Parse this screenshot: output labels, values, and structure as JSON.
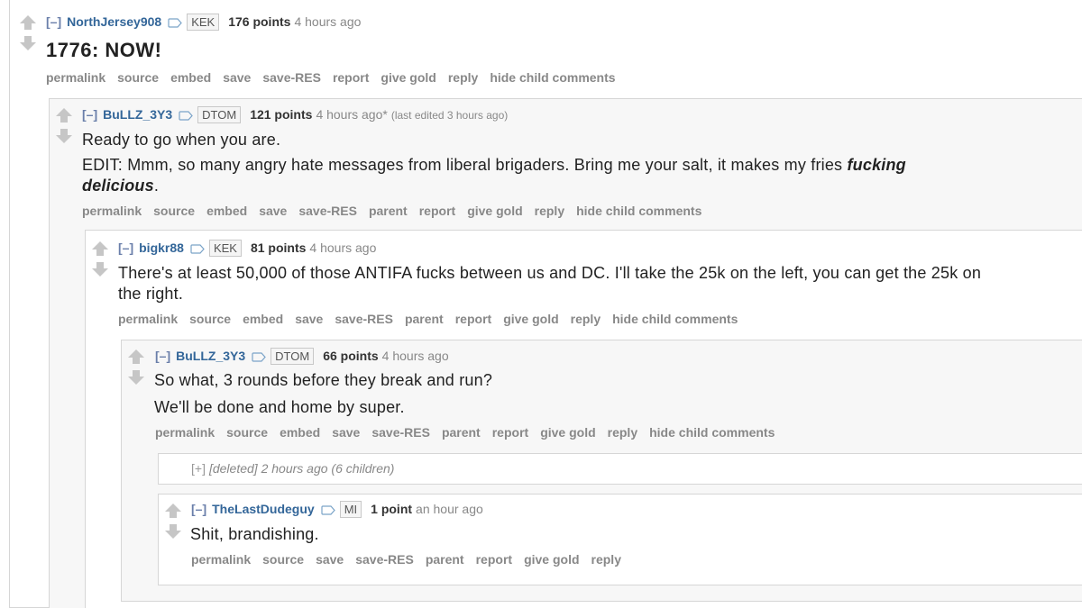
{
  "comments": [
    {
      "toggle": "[–]",
      "author": "NorthJersey908",
      "flair": "KEK",
      "score": "176 points",
      "time": "4 hours ago",
      "lines": [
        "1776: NOW!"
      ],
      "buttons": [
        "permalink",
        "source",
        "embed",
        "save",
        "save-RES",
        "report",
        "give gold",
        "reply",
        "hide child comments"
      ]
    },
    {
      "toggle": "[–]",
      "author": "BuLLZ_3Y3",
      "flair": "DTOM",
      "score": "121 points",
      "time": "4 hours ago*",
      "edited": "(last edited 3 hours ago)",
      "lines": [
        "Ready to go when you are.",
        "EDIT: Mmm, so many angry hate messages from liberal brigaders. Bring me your salt, it makes my fries"
      ],
      "emphasis_1": "fucking",
      "emphasis_2": "delicious",
      "line_end": ".",
      "buttons": [
        "permalink",
        "source",
        "embed",
        "save",
        "save-RES",
        "parent",
        "report",
        "give gold",
        "reply",
        "hide child comments"
      ]
    },
    {
      "toggle": "[–]",
      "author": "bigkr88",
      "flair": "KEK",
      "score": "81 points",
      "time": "4 hours ago",
      "lines": [
        "There's at least 50,000 of those ANTIFA fucks between us and DC. I'll take the 25k on the left, you can get the 25k on",
        "the right."
      ],
      "buttons": [
        "permalink",
        "source",
        "embed",
        "save",
        "save-RES",
        "parent",
        "report",
        "give gold",
        "reply",
        "hide child comments"
      ]
    },
    {
      "toggle": "[–]",
      "author": "BuLLZ_3Y3",
      "flair": "DTOM",
      "score": "66 points",
      "time": "4 hours ago",
      "lines": [
        "So what, 3 rounds before they break and run?",
        "We'll be done and home by super."
      ],
      "buttons": [
        "permalink",
        "source",
        "embed",
        "save",
        "save-RES",
        "parent",
        "report",
        "give gold",
        "reply",
        "hide child comments"
      ]
    },
    {
      "toggle": "[+]",
      "collapsed_text": "[deleted] 2 hours ago (6 children)"
    },
    {
      "toggle": "[–]",
      "author": "TheLastDudeguy",
      "flair": "MI",
      "score": "1 point",
      "time": "an hour ago",
      "lines": [
        "Shit, brandishing."
      ],
      "buttons": [
        "permalink",
        "source",
        "save",
        "save-RES",
        "parent",
        "report",
        "give gold",
        "reply"
      ]
    }
  ],
  "colors": {
    "link": "#336699",
    "muted": "#888888",
    "alt_bg": "#f7f7f7",
    "border": "#d6d6d6"
  },
  "icons": {
    "upvote": "upvote-arrow-icon",
    "downvote": "downvote-arrow-icon",
    "tag": "tag-icon"
  }
}
